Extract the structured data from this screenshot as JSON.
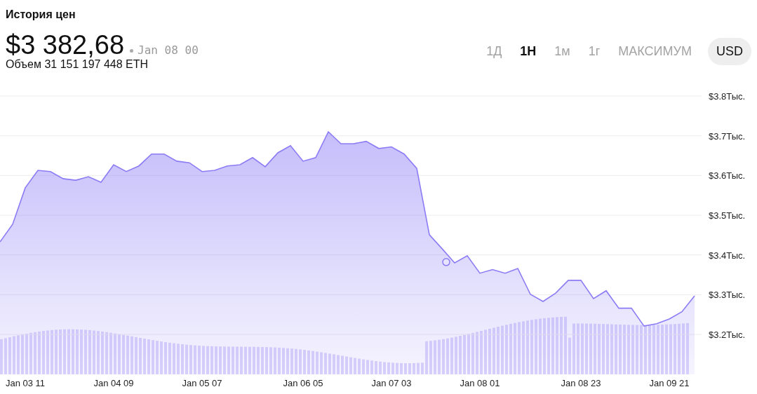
{
  "title": "История цен",
  "price": "$3 382,68",
  "price_time": "Jan 08 00",
  "volume": "Объем 31 151 197 448 ETH",
  "ranges": [
    {
      "label": "1Д",
      "selected": false
    },
    {
      "label": "1Н",
      "selected": true
    },
    {
      "label": "1м",
      "selected": false
    },
    {
      "label": "1г",
      "selected": false
    },
    {
      "label": "МАКСИМУМ",
      "selected": false
    }
  ],
  "currency": "USD",
  "chart": {
    "chart_data": {
      "type": "area",
      "categories": [
        null,
        null,
        "Jan 03 11",
        null,
        null,
        null,
        null,
        null,
        null,
        "Jan 04 09",
        null,
        null,
        null,
        null,
        null,
        null,
        "Jan 05 07",
        null,
        null,
        null,
        null,
        null,
        null,
        null,
        "Jan 06 05",
        null,
        null,
        null,
        null,
        null,
        null,
        "Jan 07 03",
        null,
        null,
        null,
        null,
        null,
        null,
        "Jan 08 01",
        null,
        null,
        null,
        null,
        null,
        null,
        null,
        "Jan 08 23",
        null,
        null,
        null,
        null,
        null,
        null,
        "Jan 09 21",
        null,
        null
      ],
      "series": [
        {
          "color": "#8b7cf6",
          "values": [
            3.433,
            3.477,
            3.569,
            3.613,
            3.61,
            3.592,
            3.588,
            3.597,
            3.583,
            3.627,
            3.61,
            3.624,
            3.654,
            3.654,
            3.636,
            3.632,
            3.61,
            3.613,
            3.624,
            3.627,
            3.645,
            3.622,
            3.657,
            3.675,
            3.636,
            3.645,
            3.71,
            3.68,
            3.68,
            3.686,
            3.668,
            3.672,
            3.654,
            3.618,
            3.451,
            3.416,
            3.38,
            3.398,
            3.354,
            3.363,
            3.354,
            3.366,
            3.301,
            3.283,
            3.304,
            3.336,
            3.336,
            3.29,
            3.31,
            3.266,
            3.266,
            3.221,
            3.227,
            3.239,
            3.257,
            3.297
          ]
        }
      ],
      "grid": true,
      "ylim": [
        3.2,
        3.8
      ],
      "yticks": [
        {
          "value": 3.8,
          "label": "$3.8Тыс."
        },
        {
          "value": 3.7,
          "label": "$3.7Тыс."
        },
        {
          "value": 3.6,
          "label": "$3.6Тыс."
        },
        {
          "value": 3.5,
          "label": "$3.5Тыс."
        },
        {
          "value": 3.4,
          "label": "$3.4Тыс."
        },
        {
          "value": 3.3,
          "label": "$3.3Тыс."
        },
        {
          "value": 3.2,
          "label": "$3.2Тыс."
        }
      ]
    }
  }
}
